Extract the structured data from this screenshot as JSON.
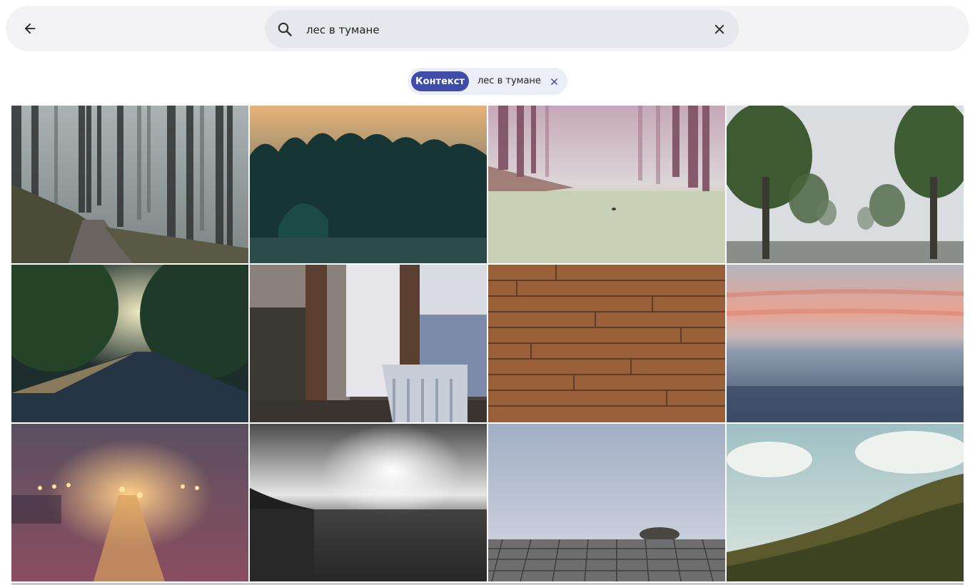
{
  "search": {
    "query": "лес в тумане",
    "placeholder": ""
  },
  "filter_chip": {
    "badge": "Контекст",
    "text": "лес в тумане"
  },
  "colors": {
    "accent": "#3f4da8",
    "chip_bg": "#eceef7",
    "search_bg": "#e7e8ed",
    "bar_bg": "#f3f3f5"
  },
  "icons": {
    "back": "arrow-left-icon",
    "search": "search-icon",
    "clear": "close-icon",
    "chip_close": "close-icon"
  },
  "images": [
    "foggy-forest-path",
    "dark-pine-forest-sunset",
    "misty-tree-lined-road-pink",
    "foggy-tree-alley-road",
    "sunlit-road-through-trees",
    "window-frames-with-chair",
    "wooden-plank-texture",
    "pink-sky-above-fog-sea",
    "foggy-railway-station-night",
    "black-and-white-sunrise-field",
    "wooden-pier-with-rock-in-fog",
    "green-hillside-under-sky"
  ]
}
